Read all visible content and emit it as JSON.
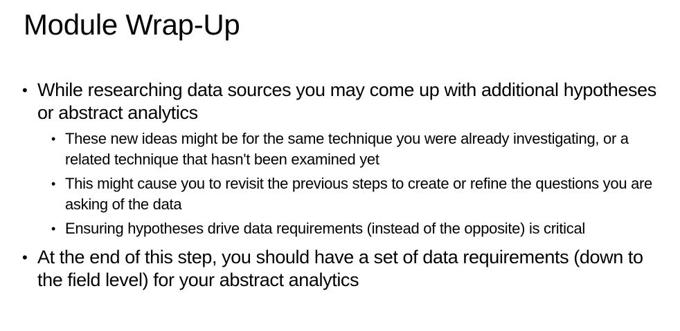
{
  "slide": {
    "title": "Module Wrap-Up",
    "bullet_glyph": "•",
    "bullets": [
      {
        "text": "While researching data sources you may come up with additional hypotheses or abstract analytics",
        "sub": [
          "These new ideas might be for the same technique you were already investigating, or a related technique that hasn't been examined yet",
          "This might cause you to revisit the previous steps to create or refine the questions you are asking of the data",
          "Ensuring hypotheses drive data requirements (instead of the opposite) is critical"
        ]
      },
      {
        "text": "At the end of this step, you should have a set of data requirements (down to the field level) for your abstract analytics"
      }
    ]
  }
}
